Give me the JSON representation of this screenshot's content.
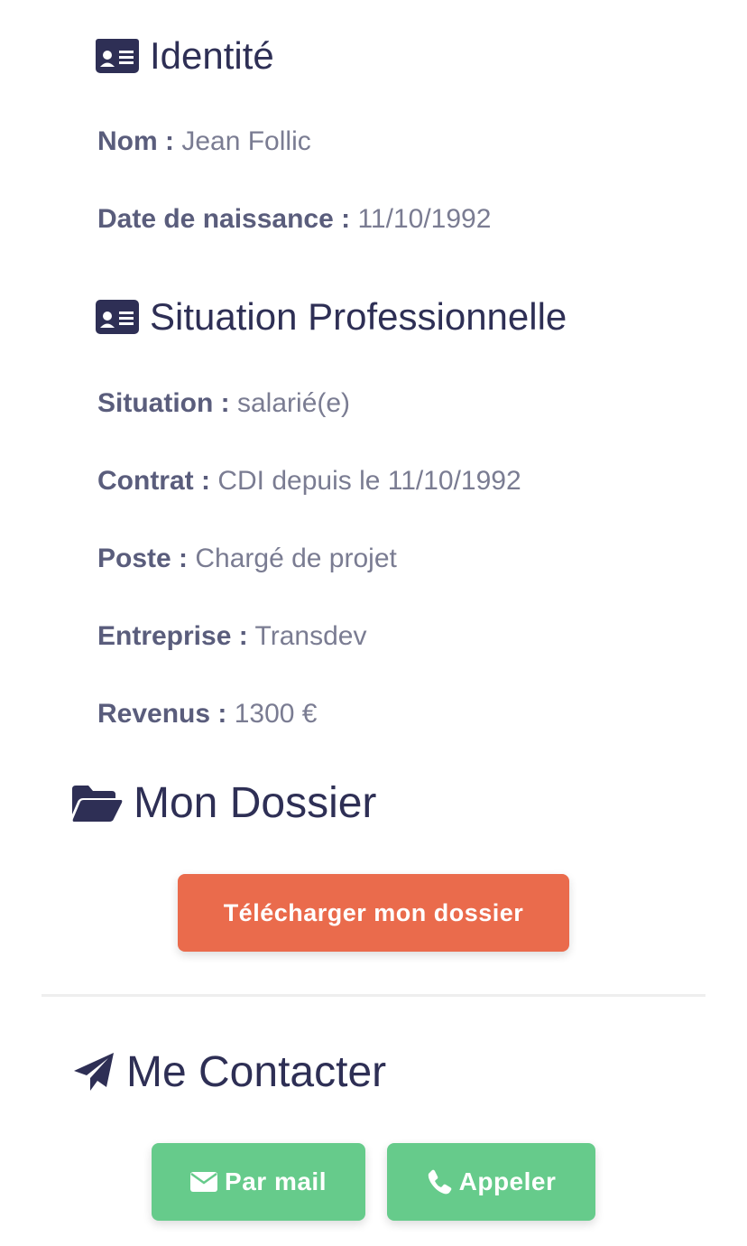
{
  "identity": {
    "title": "Identité",
    "icon": "id-card-icon",
    "fields": [
      {
        "label": "Nom :",
        "value": "Jean Follic"
      },
      {
        "label": "Date de naissance :",
        "value": "11/10/1992"
      }
    ]
  },
  "professional": {
    "title": "Situation Professionnelle",
    "icon": "id-card-icon",
    "fields": [
      {
        "label": "Situation :",
        "value": "salarié(e)"
      },
      {
        "label": "Contrat :",
        "value": "CDI depuis le 11/10/1992"
      },
      {
        "label": "Poste :",
        "value": "Chargé de projet"
      },
      {
        "label": "Entreprise :",
        "value": "Transdev"
      },
      {
        "label": "Revenus :",
        "value": "1300 €"
      }
    ]
  },
  "dossier": {
    "title": "Mon Dossier",
    "icon": "folder-open-icon",
    "download_label": "Télécharger mon dossier"
  },
  "contact": {
    "title": "Me Contacter",
    "icon": "paper-plane-icon",
    "mail_label": "Par mail",
    "mail_icon": "envelope-icon",
    "call_label": "Appeler",
    "call_icon": "phone-icon"
  },
  "colors": {
    "heading": "#2e2f55",
    "label": "#5a5d7c",
    "value": "#7a7c92",
    "download_button": "#ea6b4c",
    "contact_buttons": "#66cb8b"
  }
}
